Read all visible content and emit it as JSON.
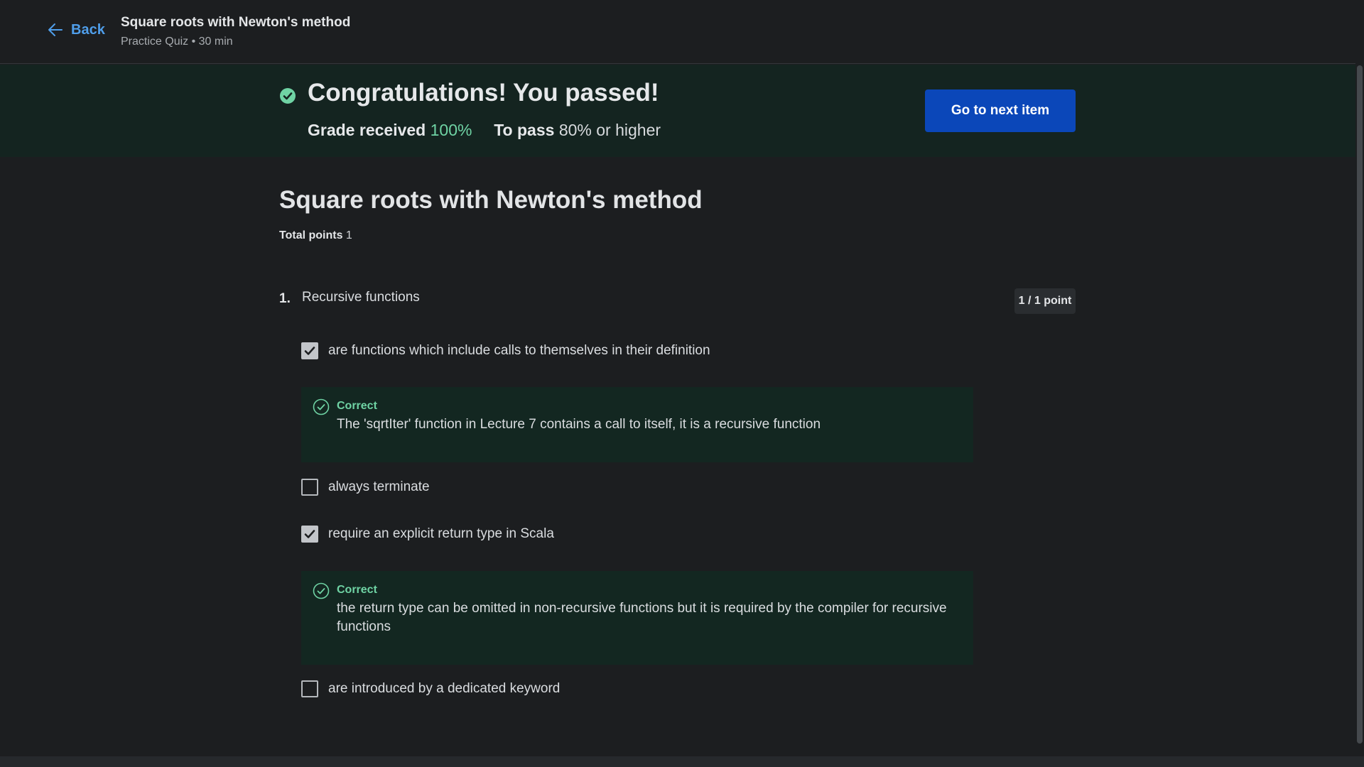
{
  "header": {
    "back_label": "Back",
    "title": "Square roots with Newton's method",
    "subtitle": "Practice Quiz • 30 min"
  },
  "banner": {
    "headline": "Congratulations! You passed!",
    "grade_label": "Grade received",
    "grade_value": "100%",
    "pass_label": "To pass",
    "pass_value": "80% or higher",
    "next_button": "Go to next item",
    "accent_color": "#6fd3a4"
  },
  "quiz": {
    "title": "Square roots with Newton's method",
    "total_points_label": "Total points",
    "total_points_value": "1"
  },
  "question": {
    "number": "1.",
    "text": "Recursive functions",
    "points": "1 / 1 point",
    "options": [
      {
        "text": "are functions which include calls to themselves in their definition",
        "checked": true,
        "feedback_label": "Correct",
        "feedback_text": "The 'sqrtIter' function in Lecture 7 contains a call to itself, it is a recursive function"
      },
      {
        "text": "always terminate",
        "checked": false
      },
      {
        "text": "require an explicit return type in Scala",
        "checked": true,
        "feedback_label": "Correct",
        "feedback_text": "the return type can be omitted in non-recursive functions but it is required by the compiler for recursive functions"
      },
      {
        "text": "are introduced by a dedicated keyword",
        "checked": false
      }
    ]
  },
  "icons": {
    "back": "arrow-left-icon",
    "banner_status": "check-circle-filled-icon",
    "feedback_status": "check-circle-outline-icon",
    "checkbox_checked": "checkmark-icon"
  }
}
